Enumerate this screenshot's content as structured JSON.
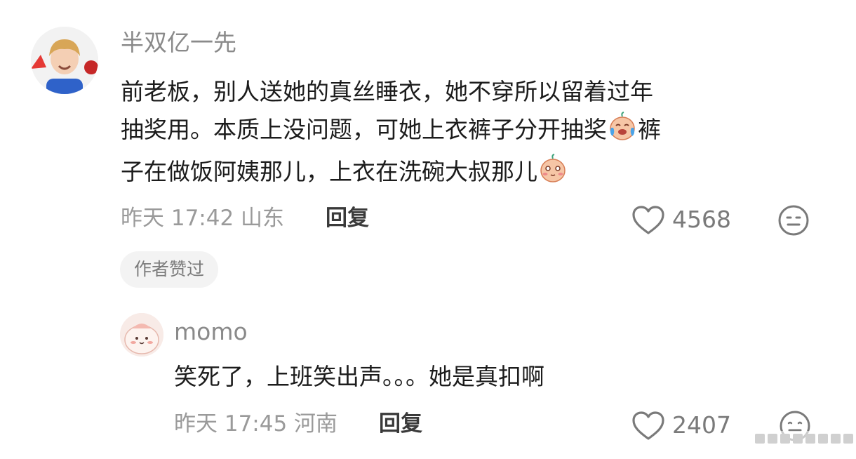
{
  "comments": [
    {
      "username": "半双亿一先",
      "text_lines": [
        "前老板，别人送她的真丝睡衣，她不穿所以留着过年",
        "抽奖用。本质上没问题，可她上衣裤子分开抽奖",
        "裤",
        "子在做饭阿姨那儿，上衣在洗碗大叔那儿"
      ],
      "meta": "昨天 17:42 山东",
      "reply_label": "回复",
      "likes": "4568",
      "badge": "作者赞过"
    },
    {
      "username": "momo",
      "text": "笑死了，上班笑出声。。。她是真扣啊",
      "meta": "昨天 17:45 河南",
      "reply_label": "回复",
      "likes": "2407"
    }
  ],
  "icons": {
    "like": "heart-outline-icon",
    "react": "smiley-face-icon",
    "emoji_cry": "crying-laugh-emoji",
    "emoji_shy": "shy-emoji"
  },
  "colors": {
    "username": "#8a8a8a",
    "meta": "#9a9a9a",
    "text": "#1c1c1c",
    "badge_bg": "#f3f3f3"
  }
}
